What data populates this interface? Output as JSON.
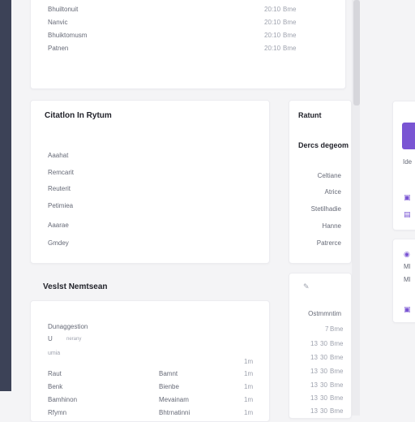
{
  "top_list": {
    "rows": [
      {
        "label": "Bhuiltonuit",
        "value": "20:10",
        "unit": "Bme"
      },
      {
        "label": "Nanvic",
        "value": "20:10",
        "unit": "Bme"
      },
      {
        "label": "Bhuiktomusm",
        "value": "20:10",
        "unit": "Bme"
      },
      {
        "label": "Patnen",
        "value": "20:10",
        "unit": "Bme"
      }
    ]
  },
  "citation_card": {
    "title": "Citatlon In Rytum",
    "items": [
      "Aaahat",
      "Remcarit",
      "Reuterit",
      "Petimiea",
      "Aaarae",
      "Gmdey"
    ]
  },
  "right_card": {
    "title": "Ratunt",
    "subtitle": "Dercs degeom",
    "items": [
      "Celtiane",
      "Atrice",
      "Stetilhadie",
      "Hanne",
      "Patrerce"
    ]
  },
  "vendor_card": {
    "title": "Veslst Nemtsean",
    "label1": "Dunaggestion",
    "label2_prefix": "U",
    "label2_suffix": "nerany",
    "label3": "umia",
    "header_value": "1m",
    "rows": [
      {
        "left": "Raut",
        "mid": "Bamnt",
        "right": "1m"
      },
      {
        "left": "Benk",
        "mid": "Bienbe",
        "right": "1m"
      },
      {
        "left": "Bamhinon",
        "mid": "Mevainam",
        "right": "1m"
      },
      {
        "left": "Rfymn",
        "mid": "Bhtrnatinni",
        "right": "1m"
      }
    ]
  },
  "schedule_card": {
    "icon": "pencil-icon",
    "header": "Ostmmntim",
    "rows": [
      {
        "h": "",
        "m": "7",
        "unit": "Bme"
      },
      {
        "h": "13",
        "m": "30",
        "unit": "Bme"
      },
      {
        "h": "13",
        "m": "30",
        "unit": "Bme"
      },
      {
        "h": "13",
        "m": "30",
        "unit": "Bme"
      },
      {
        "h": "13",
        "m": "30",
        "unit": "Bme"
      },
      {
        "h": "13",
        "m": "30",
        "unit": "Bme"
      },
      {
        "h": "13",
        "m": "30",
        "unit": "Bme"
      }
    ]
  },
  "side_panel": {
    "label": "Ide",
    "lower_labels": [
      "Ml",
      "Ml"
    ],
    "icons": [
      "calendar-icon",
      "message-icon",
      "location-icon",
      "image-icon"
    ]
  },
  "colors": {
    "accent": "#7a55d3",
    "sidebar": "#3c4257"
  }
}
